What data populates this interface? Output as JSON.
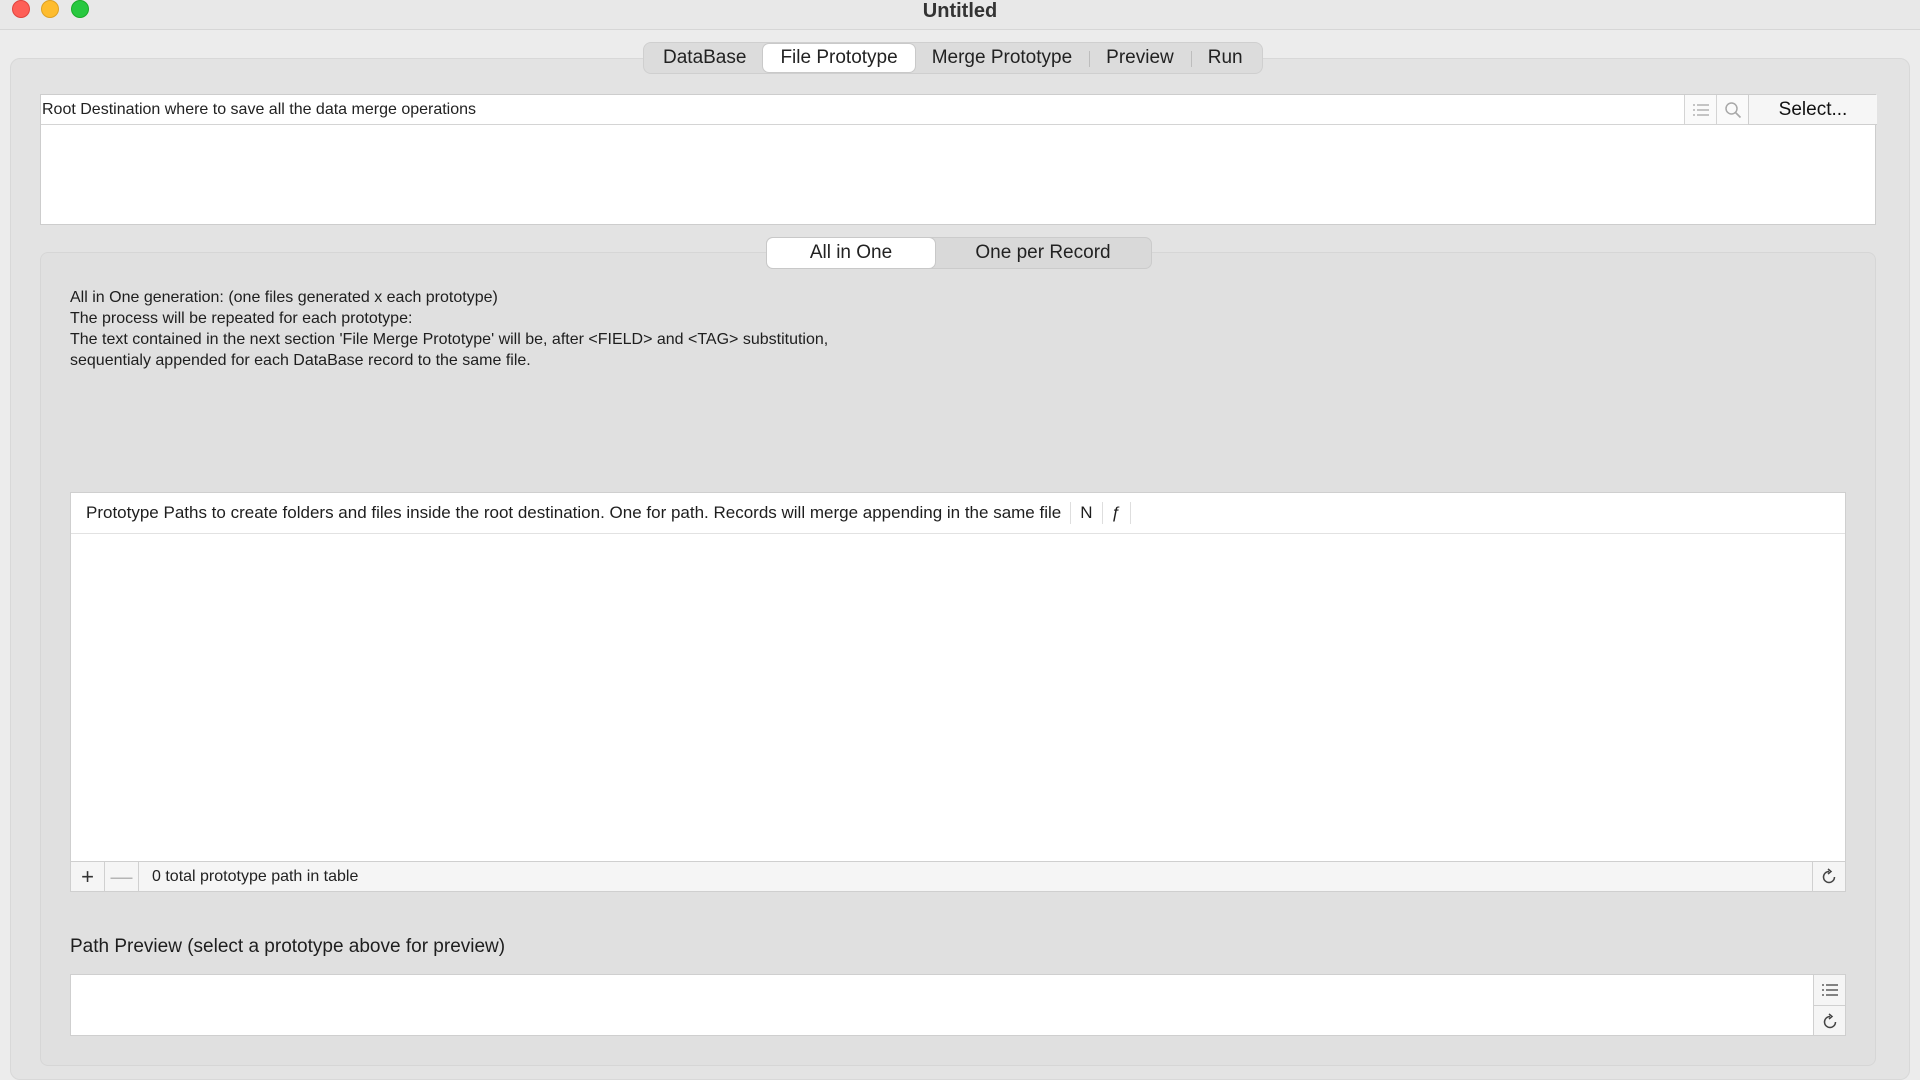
{
  "window": {
    "title": "Untitled"
  },
  "tabs": [
    {
      "label": "DataBase",
      "active": false
    },
    {
      "label": "File Prototype",
      "active": true
    },
    {
      "label": "Merge Prototype",
      "active": false
    },
    {
      "label": "Preview",
      "active": false
    },
    {
      "label": "Run",
      "active": false
    }
  ],
  "root": {
    "label": "Root Destination where to save all the data merge operations",
    "select_label": "Select..."
  },
  "mode": {
    "options": [
      {
        "label": "All in One",
        "active": true
      },
      {
        "label": "One per Record",
        "active": false
      }
    ]
  },
  "description": {
    "lines": [
      "All in One generation: (one files generated x each prototype)",
      "The process will be repeated for each prototype:",
      "The text contained in the next section 'File Merge Prototype' will be, after <FIELD> and <TAG> substitution,",
      "sequentialy appended for each DataBase record to the same file."
    ]
  },
  "prototype_table": {
    "columns": [
      "Prototype Paths to create folders and  files inside the root destination. One for path. Records will merge appending in the same file",
      "N",
      "ƒ"
    ],
    "rows": [],
    "add_label": "+",
    "remove_label": "—",
    "status": "0 total prototype path in table"
  },
  "path_preview": {
    "label": "Path Preview (select a prototype above for preview)"
  },
  "icons": {
    "root_list": "list-icon",
    "root_search": "search-icon",
    "table_refresh": "refresh-icon",
    "preview_list": "list-icon",
    "preview_refresh": "refresh-icon"
  },
  "colors": {
    "close": "#fe5f57",
    "minimize": "#febc2e",
    "maximize": "#28c840"
  }
}
